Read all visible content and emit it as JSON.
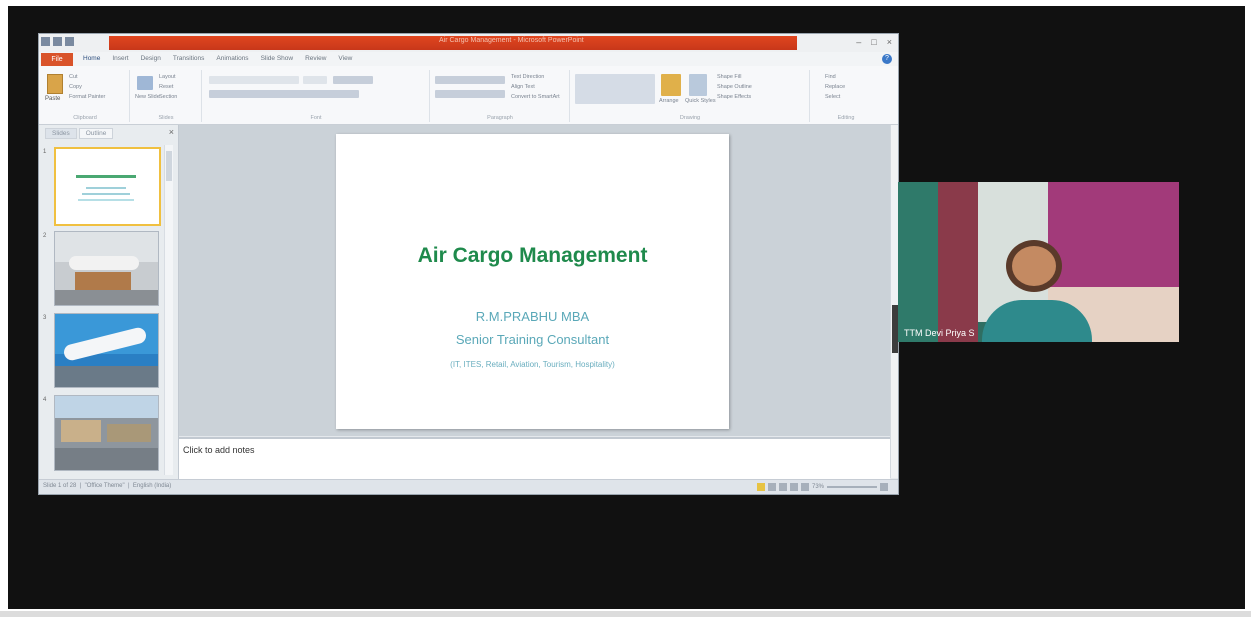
{
  "window": {
    "doc_title": "Air Cargo Management - Microsoft PowerPoint",
    "file_tab": "File",
    "tabs": [
      "Home",
      "Insert",
      "Design",
      "Transitions",
      "Animations",
      "Slide Show",
      "Review",
      "View"
    ],
    "active_tab": "Home"
  },
  "ribbon": {
    "paste_label": "Paste",
    "clipboard": [
      "Cut",
      "Copy",
      "Format Painter"
    ],
    "slides_group": [
      "Layout",
      "Reset",
      "Section"
    ],
    "new_slide_label": "New Slide",
    "paragraph_tools": [
      "Text Direction",
      "Align Text",
      "Convert to SmartArt"
    ],
    "drawing_tools": [
      "Shape Fill",
      "Shape Outline",
      "Shape Effects"
    ],
    "arrange_label": "Arrange",
    "quick_styles_label": "Quick Styles",
    "editing_tools": [
      "Find",
      "Replace",
      "Select"
    ],
    "group_labels": [
      "Clipboard",
      "Slides",
      "Font",
      "Paragraph",
      "Drawing",
      "Editing"
    ]
  },
  "panel": {
    "tabs": [
      "Slides",
      "Outline"
    ],
    "active_tab": "Slides",
    "slide_numbers": [
      "1",
      "2",
      "3",
      "4"
    ]
  },
  "slide": {
    "title": "Air Cargo Management",
    "author": "R.M.PRABHU MBA",
    "role": "Senior Training Consultant",
    "sectors": "(IT, ITES, Retail, Aviation, Tourism, Hospitality)"
  },
  "notes": {
    "placeholder": "Click to add notes"
  },
  "status": {
    "slide_info": "Slide 1 of 28",
    "theme": "\"Office Theme\"",
    "language": "English (India)",
    "zoom": "73%"
  },
  "webcam": {
    "participant_name": "TTM Devi Priya S"
  },
  "colors": {
    "title_green": "#1f8a4c",
    "subtitle_teal": "#5aa8b8",
    "titlebar_red": "#d9462a",
    "background": "#111111"
  }
}
